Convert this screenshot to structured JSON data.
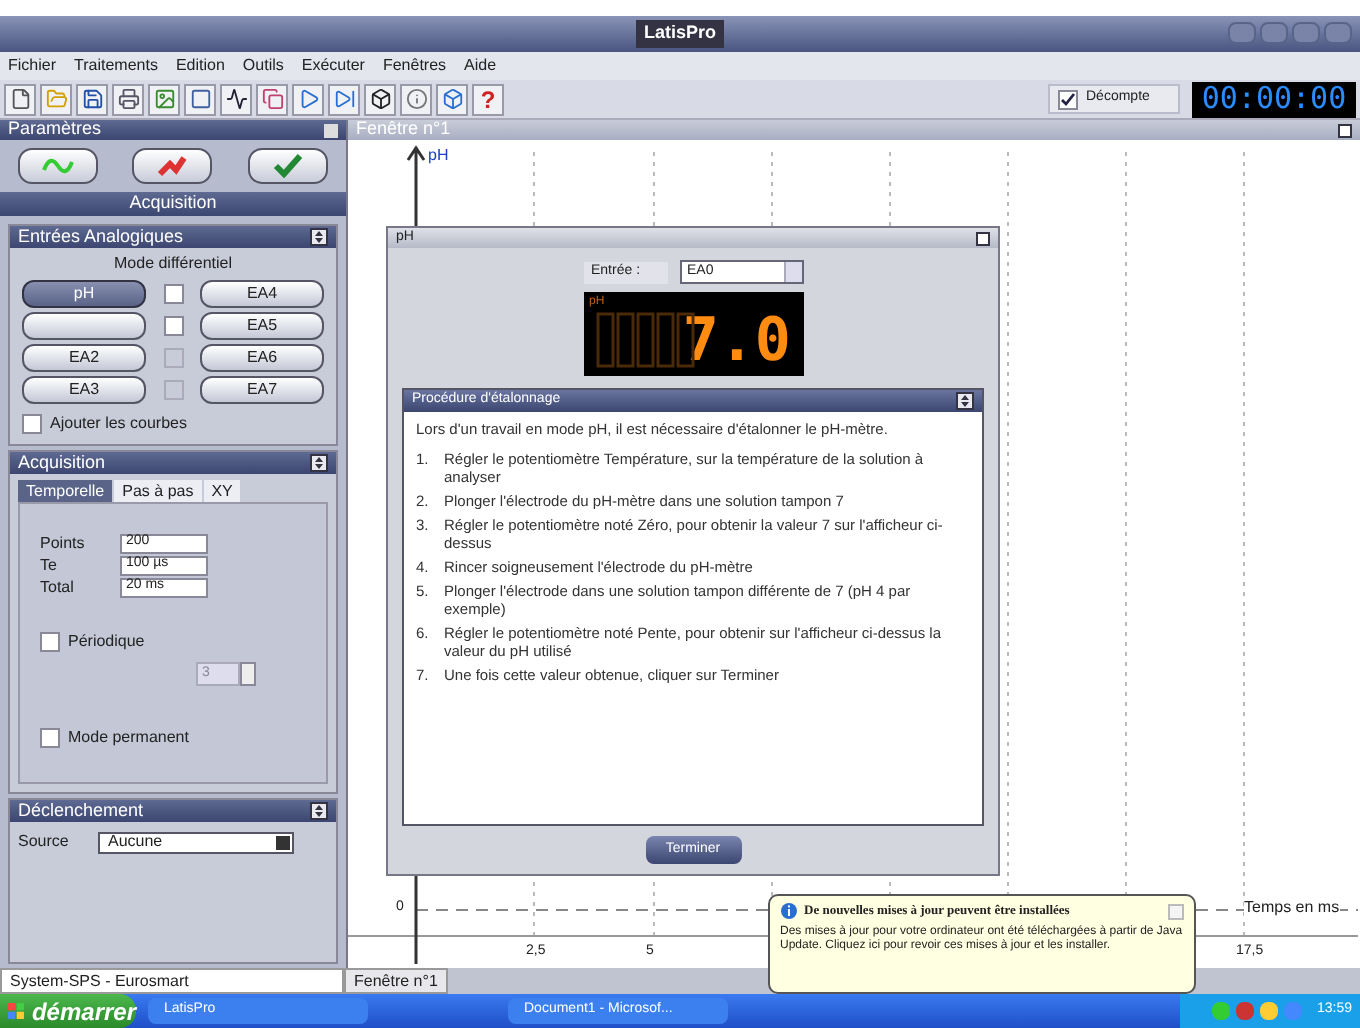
{
  "window": {
    "title": "LatisPro"
  },
  "menu": [
    "Fichier",
    "Traitements",
    "Edition",
    "Outils",
    "Exécuter",
    "Fenêtres",
    "Aide"
  ],
  "toolbar": {
    "help_glyph": "?",
    "countdown": {
      "label": "Décompte",
      "checked": true
    },
    "timer": "00:00:00"
  },
  "parameters": {
    "title": "Paramètres",
    "section": "Acquisition",
    "analog_inputs": {
      "title": "Entrées Analogiques",
      "mode_label": "Mode différentiel",
      "rows": [
        {
          "left": {
            "label": "pH",
            "selected": true
          },
          "differential": {
            "checked": false,
            "disabled": false
          },
          "right": {
            "label": "EA4",
            "selected": false
          }
        },
        {
          "left": {
            "selected": false
          },
          "differential": {
            "checked": false,
            "disabled": false
          },
          "right": {
            "label": "EA5",
            "selected": false
          }
        },
        {
          "left": {
            "label": "EA2",
            "selected": false
          },
          "differential": {
            "checked": false,
            "disabled": true
          },
          "right": {
            "label": "EA6",
            "selected": false
          }
        },
        {
          "left": {
            "label": "EA3",
            "selected": false
          },
          "differential": {
            "checked": false,
            "disabled": true
          },
          "right": {
            "label": "EA7",
            "selected": false
          }
        }
      ],
      "add_curves": {
        "label": "Ajouter les courbes",
        "checked": false
      }
    },
    "acquisition": {
      "title": "Acquisition",
      "tabs": [
        {
          "label": "Temporelle",
          "selected": true
        },
        {
          "label": "Pas à pas",
          "selected": false
        },
        {
          "label": "XY",
          "selected": false
        }
      ],
      "fields": [
        {
          "label": "Points",
          "value": "200"
        },
        {
          "label": "Te",
          "value": "100 µs"
        },
        {
          "label": "Total",
          "value": "20 ms"
        }
      ],
      "periodic": {
        "label": "Périodique",
        "checked": false
      },
      "periods_value": "3",
      "permanent": {
        "label": "Mode permanent",
        "checked": false
      }
    },
    "trigger": {
      "title": "Déclenchement",
      "source_label": "Source",
      "source_value": "Aucune"
    }
  },
  "graph": {
    "title": "Fenêtre n°1",
    "y_label": "pH",
    "y_tick": "0",
    "x_ticks": [
      "2,5",
      "5",
      "17,5"
    ],
    "x_label": "Temps en ms"
  },
  "ph_dialog": {
    "title": "pH",
    "input_label": "Entrée :",
    "input_value": "EA0",
    "display_unit": "pH",
    "display_value": "7.0",
    "procedure": {
      "title": "Procédure d'étalonnage",
      "intro": "Lors d'un travail en mode pH, il est nécessaire d'étalonner le pH-mètre.",
      "steps": [
        {
          "number": "1.",
          "text": "Régler le potentiomètre Température, sur la température de la solution à analyser"
        },
        {
          "number": "2.",
          "text": "Plonger l'électrode du pH-mètre dans une solution tampon 7"
        },
        {
          "number": "3.",
          "text": "Régler le potentiomètre noté Zéro, pour obtenir la valeur 7 sur l'afficheur ci-dessus"
        },
        {
          "number": "4.",
          "text": "Rincer soigneusement l'électrode du pH-mètre"
        },
        {
          "number": "5.",
          "text": "Plonger l'électrode dans une solution tampon différente de 7 (pH 4 par exemple)"
        },
        {
          "number": "6.",
          "text": "Régler le potentiomètre noté Pente, pour obtenir sur l'afficheur ci-dessus la valeur du pH utilisé"
        },
        {
          "number": "7.",
          "text": "Une fois cette valeur obtenue, cliquer sur Terminer"
        }
      ]
    },
    "button": "Terminer"
  },
  "status_bar": {
    "left": "System-SPS - Eurosmart",
    "tab": "Fenêtre n°1"
  },
  "notification": {
    "title": "De nouvelles mises à jour peuvent être installées",
    "body": "Des mises à jour pour votre ordinateur ont été téléchargées à partir de Java Update. Cliquez ici pour revoir ces mises à jour et les installer."
  },
  "taskbar": {
    "start": "démarrer",
    "tasks": [
      {
        "label": "LatisPro",
        "selected": false
      },
      {
        "label": "Document1 - Microsof...",
        "selected": false
      }
    ],
    "clock": "13:59"
  }
}
